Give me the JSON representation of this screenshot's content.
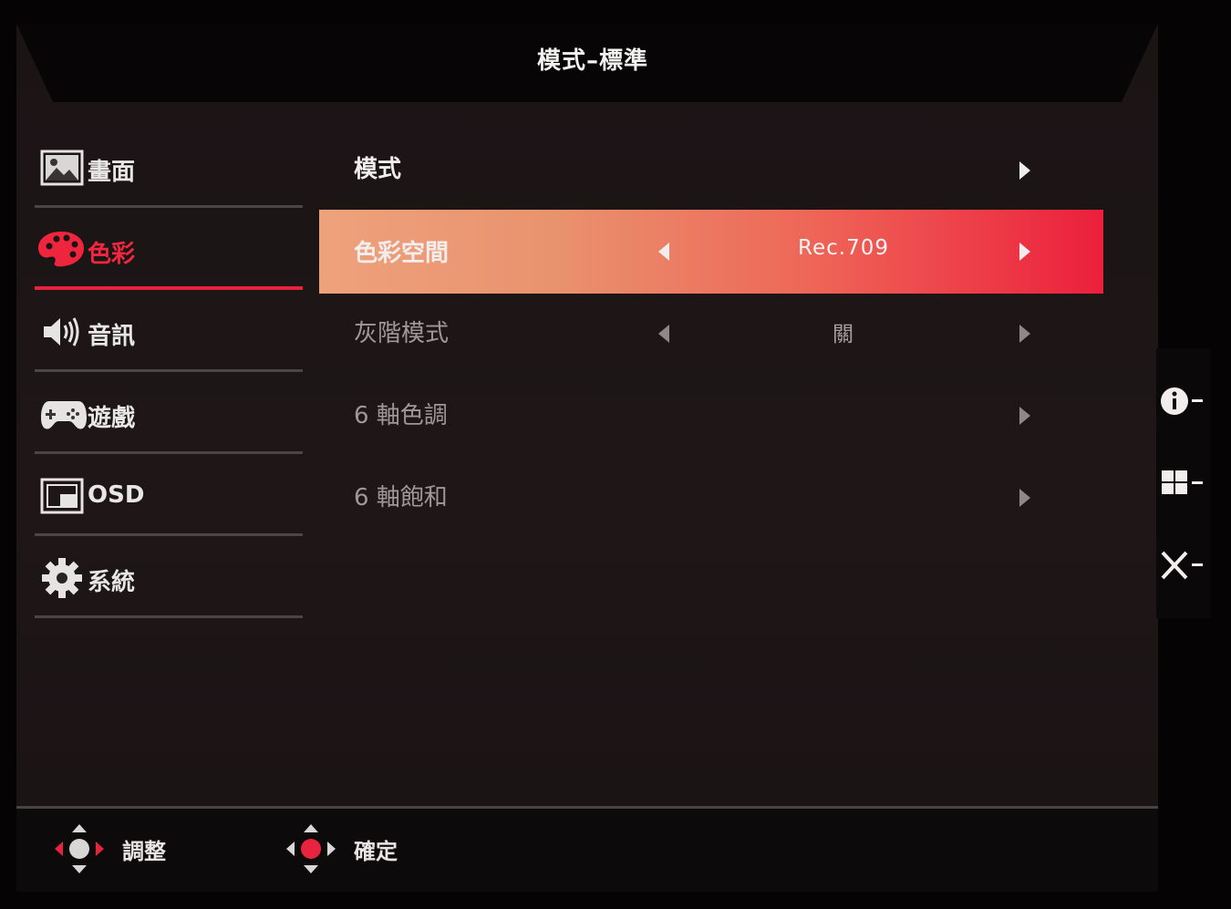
{
  "header": {
    "title": "模式–標準"
  },
  "sidebar": {
    "items": [
      {
        "label": "畫面",
        "icon": "picture-icon",
        "active": false
      },
      {
        "label": "色彩",
        "icon": "palette-icon",
        "active": true
      },
      {
        "label": "音訊",
        "icon": "speaker-icon",
        "active": false
      },
      {
        "label": "遊戲",
        "icon": "gamepad-icon",
        "active": false
      },
      {
        "label": "OSD",
        "icon": "osd-window-icon",
        "active": false
      },
      {
        "label": "系統",
        "icon": "gear-icon",
        "active": false
      }
    ]
  },
  "main": {
    "rows": [
      {
        "label": "模式",
        "value": ""
      },
      {
        "label": "色彩空間",
        "value": "Rec.709",
        "selected": true
      },
      {
        "label": "灰階模式",
        "value": "關"
      },
      {
        "label": "6 軸色調",
        "value": ""
      },
      {
        "label": "6 軸飽和",
        "value": ""
      }
    ]
  },
  "hotkeys": [
    {
      "icon": "info-icon"
    },
    {
      "icon": "input-grid-icon"
    },
    {
      "icon": "close-icon"
    }
  ],
  "footer": {
    "adjust_label": "調整",
    "confirm_label": "確定"
  },
  "colors": {
    "accent": "#e8233d",
    "selected_start": "#eea27c",
    "selected_end": "#ec1f3c",
    "panel": "#1c1516"
  }
}
